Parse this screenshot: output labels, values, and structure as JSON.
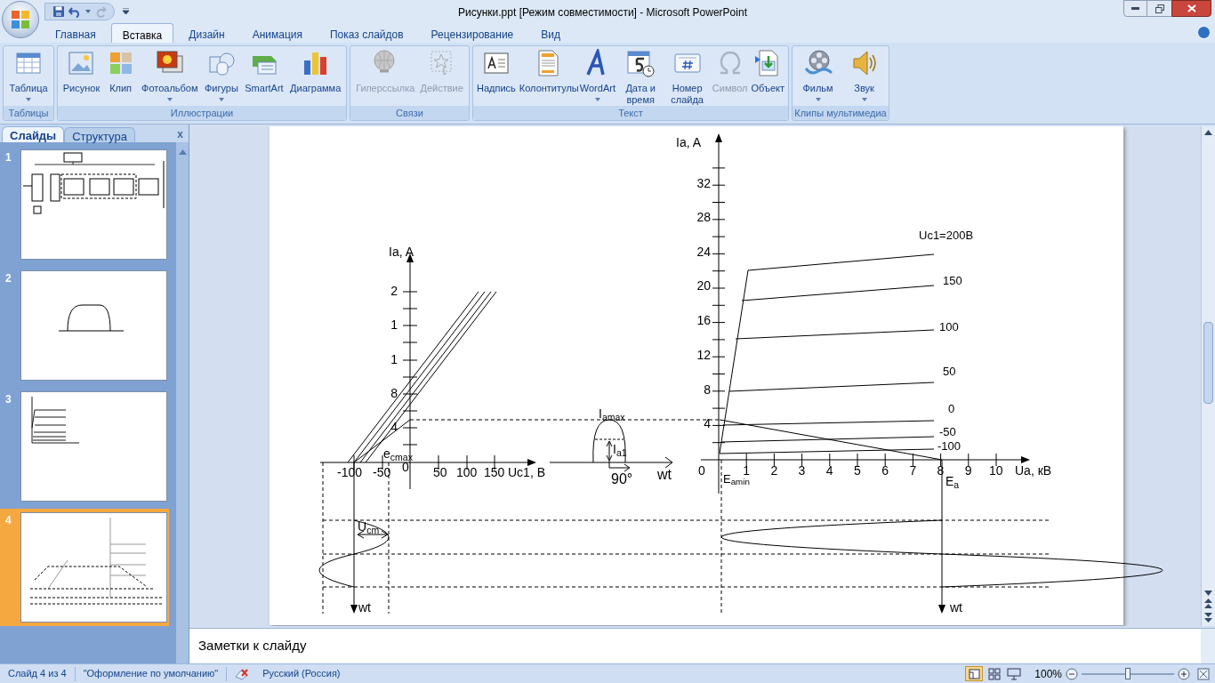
{
  "window": {
    "title": "Рисунки.ppt [Режим совместимости] - Microsoft PowerPoint"
  },
  "ribbon_tabs": [
    {
      "label": "Главная",
      "selected": false
    },
    {
      "label": "Вставка",
      "selected": true
    },
    {
      "label": "Дизайн",
      "selected": false
    },
    {
      "label": "Анимация",
      "selected": false
    },
    {
      "label": "Показ слайдов",
      "selected": false
    },
    {
      "label": "Рецензирование",
      "selected": false
    },
    {
      "label": "Вид",
      "selected": false
    }
  ],
  "ribbon_groups": [
    {
      "label": "Таблицы",
      "buttons": [
        {
          "label": "Таблица",
          "dropdown": true,
          "disabled": false
        }
      ]
    },
    {
      "label": "Иллюстрации",
      "buttons": [
        {
          "label": "Рисунок",
          "dropdown": false,
          "disabled": false
        },
        {
          "label": "Клип",
          "dropdown": false,
          "disabled": false
        },
        {
          "label": "Фотоальбом",
          "dropdown": true,
          "disabled": false
        },
        {
          "label": "Фигуры",
          "dropdown": true,
          "disabled": false
        },
        {
          "label": "SmartArt",
          "dropdown": false,
          "disabled": false
        },
        {
          "label": "Диаграмма",
          "dropdown": false,
          "disabled": false
        }
      ]
    },
    {
      "label": "Связи",
      "buttons": [
        {
          "label": "Гиперссылка",
          "dropdown": false,
          "disabled": true
        },
        {
          "label": "Действие",
          "dropdown": false,
          "disabled": true
        }
      ]
    },
    {
      "label": "Текст",
      "buttons": [
        {
          "label": "Надпись",
          "dropdown": false,
          "disabled": false
        },
        {
          "label": "Колонтитулы",
          "dropdown": false,
          "disabled": false
        },
        {
          "label": "WordArt",
          "dropdown": true,
          "disabled": false
        },
        {
          "label": "Дата и время",
          "dropdown": false,
          "disabled": false
        },
        {
          "label": "Номер слайда",
          "dropdown": false,
          "disabled": false
        },
        {
          "label": "Символ",
          "dropdown": false,
          "disabled": true
        },
        {
          "label": "Объект",
          "dropdown": false,
          "disabled": false
        }
      ]
    },
    {
      "label": "Клипы мультимедиа",
      "buttons": [
        {
          "label": "Фильм",
          "dropdown": true,
          "disabled": false
        },
        {
          "label": "Звук",
          "dropdown": true,
          "disabled": false
        }
      ]
    }
  ],
  "slides_pane": {
    "tabs": [
      {
        "label": "Слайды",
        "selected": true
      },
      {
        "label": "Структура",
        "selected": false
      }
    ],
    "close": "x",
    "slides": [
      {
        "number": "1",
        "selected": false
      },
      {
        "number": "2",
        "selected": false
      },
      {
        "number": "3",
        "selected": false
      },
      {
        "number": "4",
        "selected": true
      }
    ]
  },
  "slide": {
    "left_plot": {
      "y_label": "Ia, A",
      "y_ticks": [
        "2",
        "1",
        "1",
        "8",
        "4"
      ],
      "x_ticks": [
        "-100",
        "-50",
        "0",
        "50",
        "100",
        "150"
      ],
      "x_label": "Uc1, В",
      "annotation": "e$_{cmax}$"
    },
    "pulse": {
      "peak_label": "I$_{amax}$",
      "amplitude_label": "I$_{a1}$",
      "angle_label": "90°",
      "axis_label": "wt"
    },
    "right_plot": {
      "y_label": "Ia, A",
      "y_ticks": [
        "32",
        "28",
        "24",
        "20",
        "16",
        "12",
        "8",
        "4"
      ],
      "x_ticks": [
        "0",
        "1",
        "2",
        "3",
        "4",
        "5",
        "6",
        "7",
        "8",
        "9",
        "10"
      ],
      "x_label": "Ua, кВ",
      "curve_labels": [
        "Uc1=200В",
        "150",
        "100",
        "50",
        "0",
        "-50",
        "-100"
      ],
      "min_label": "E$_{amin}$",
      "supply_label": "E$_{a}$"
    },
    "bottom": {
      "amplitude_label": "U$_{cm}$",
      "time_labels": [
        "wt",
        "wt"
      ]
    }
  },
  "notes": {
    "placeholder": "Заметки к слайду"
  },
  "status_bar": {
    "slide": "Слайд 4 из 4",
    "theme": "\"Оформление по умолчанию\"",
    "language": "Русский (Россия)",
    "zoom": "100%",
    "zoom_slider": {
      "level": 0.5
    }
  }
}
